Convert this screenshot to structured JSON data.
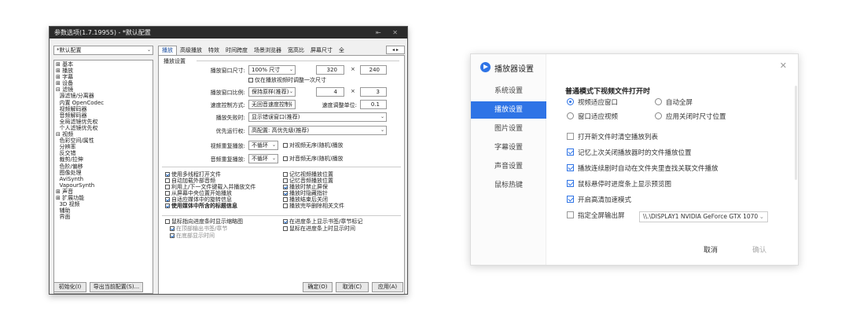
{
  "left_window": {
    "title": "参数选项(1.7.19955) - *默认配置",
    "window_controls": "⇤ ✕",
    "profile_select": "*默认配置",
    "tabs": [
      "播放",
      "高级播放",
      "特效",
      "时间跨度",
      "场景浏览器",
      "宽高比",
      "屏幕尺寸",
      "全"
    ],
    "tree": [
      "⊞ 基本",
      "⊞ 播放",
      "⊞ 字幕",
      "⊞ 设备",
      "⊟ 滤镜",
      "  源滤镜/分离器",
      "  内置 OpenCodec",
      "  视频解码器",
      "  音频解码器",
      "  全局滤镜优先权",
      "  个人滤镜优先权",
      "⊟ 视频",
      "  色彩空间/属性",
      "  分辨率",
      "  反交错",
      "  裁剪/拉伸",
      "  色阶/偏移",
      "  图像处理",
      "  AviSynth",
      "  VapourSynth",
      "⊞ 声音",
      "⊞ 扩展功能",
      "  3D 视频",
      "  辅助",
      "  界面"
    ],
    "group_title": "播放设置",
    "rows": {
      "window_size_label": "播放窗口尺寸:",
      "window_size_value": "100% 尺寸",
      "w_value": "320",
      "h_value": "240",
      "times": "×",
      "resize_once": "仅在播放视频时调整一次尺寸",
      "ratio_label": "播放窗口比例:",
      "ratio_value": "保持原样(推荐)",
      "ratio_a": "4",
      "ratio_b": "3",
      "speed_label": "速度控制方式:",
      "speed_value": "无回音速度控制(",
      "speed_unit_label": "速度调整单位:",
      "speed_unit_value": "0.1",
      "fail_label": "播放失败时:",
      "fail_value": "显示错误窗口(推荐)",
      "priority_label": "优先运行权:",
      "priority_value": "高配置: 高优先级(推荐)",
      "video_repeat_label": "视频重复播放:",
      "video_repeat_value": "不循环",
      "video_random": "对视频无序(随机)播放",
      "audio_repeat_label": "音频重复播放:",
      "audio_repeat_value": "不循环",
      "audio_random": "对音频无序(随机)播放"
    },
    "checks_left": [
      {
        "text": "使用多线程打开文件",
        "on": true
      },
      {
        "text": "自动加载外部音频",
        "on": false
      },
      {
        "text": "利用上/下一文件键载入并播放文件",
        "on": false
      },
      {
        "text": "从屏幕中央位置开始播放",
        "on": false
      },
      {
        "text": "自适应媒体中的旋转信息",
        "on": true
      },
      {
        "text": "使用媒体中所含的标题信息",
        "on": true
      }
    ],
    "checks_right": [
      {
        "text": "记忆视频播放位置",
        "on": false
      },
      {
        "text": "记忆音频播放位置",
        "on": false
      },
      {
        "text": "播放时禁止屏保",
        "on": true
      },
      {
        "text": "播放时隐藏指针",
        "on": true
      },
      {
        "text": "播放结束后关闭",
        "on": false
      },
      {
        "text": "播放完毕删除相关文件",
        "on": false
      }
    ],
    "checks_bottom": [
      {
        "text": "鼠标指向进度条时显示缩略图",
        "on": false
      },
      {
        "text": "在进度条上显示书签/章节标记",
        "on": true
      },
      {
        "text": "在顶部输出书签/章节",
        "on": true
      },
      {
        "text": "鼠标在进度条上时显示时间",
        "on": false
      },
      {
        "text": "在底部显示时间",
        "on": true
      }
    ],
    "buttons": {
      "init": "初始化(I)",
      "export": "导出当前配置(S)...",
      "ok": "确定(O)",
      "cancel": "取消(C)",
      "apply": "应用(A)"
    }
  },
  "right_dialog": {
    "title": "播放器设置",
    "close": "✕",
    "sidebar": [
      "系统设置",
      "播放设置",
      "图片设置",
      "字幕设置",
      "声音设置",
      "鼠标热键"
    ],
    "active_index": 1,
    "section_title": "普通模式下视频文件打开时",
    "radios": [
      {
        "text": "视频适应窗口",
        "on": true
      },
      {
        "text": "自动全屏",
        "on": false
      },
      {
        "text": "窗口适应视频",
        "on": false
      },
      {
        "text": "应用关闭时尺寸位置",
        "on": false
      }
    ],
    "checks": [
      {
        "text": "打开新文件时清空播放列表",
        "on": false
      },
      {
        "text": "记忆上次关闭播放器时的文件播放位置",
        "on": true
      },
      {
        "text": "播放连续剧时自动在文件夹里查找关联文件播放",
        "on": true
      },
      {
        "text": "鼠标悬停时进度条上显示预览图",
        "on": true
      },
      {
        "text": "开启高清加速模式",
        "on": true
      },
      {
        "text": "指定全屏输出屏",
        "on": false
      }
    ],
    "display_select": "\\\\.\\DISPLAY1 NVIDIA GeForce GTX 1070",
    "cancel": "取消",
    "confirm": "确认",
    "accent": "#2f74e6"
  }
}
